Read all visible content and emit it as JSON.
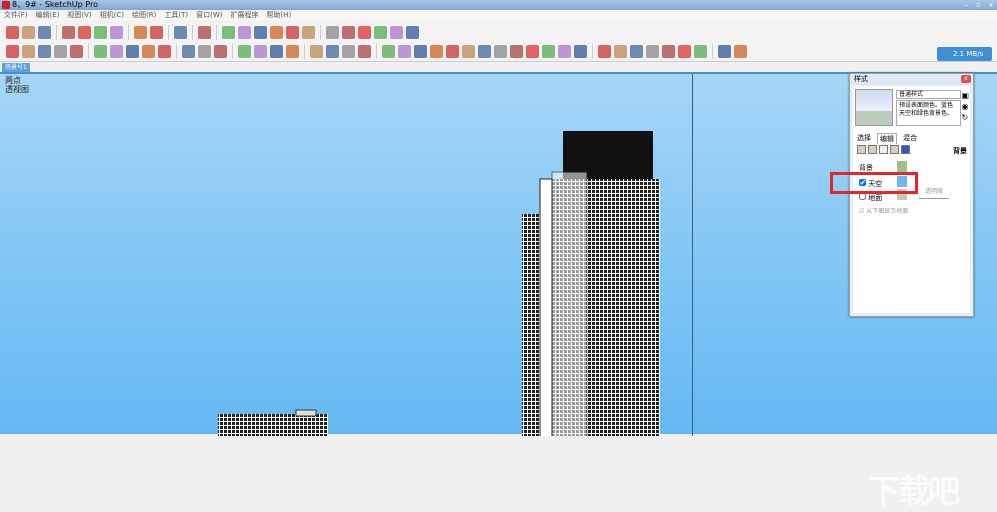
{
  "window": {
    "title": "8、9# - SketchUp Pro",
    "minimize": "–",
    "maximize": "▫",
    "close": "x"
  },
  "menu": [
    "文件(F)",
    "编辑(E)",
    "视图(V)",
    "相机(C)",
    "绘图(R)",
    "工具(T)",
    "窗口(W)",
    "扩展程序",
    "帮助(H)"
  ],
  "toolbar1": [
    "new-icon",
    "open-icon",
    "save-icon",
    "sep",
    "cut-icon",
    "copy-icon",
    "paste-icon",
    "erase-icon",
    "sep",
    "undo-icon",
    "redo-icon",
    "sep",
    "print-icon",
    "sep",
    "model-info-icon",
    "sep",
    "iso-view-icon",
    "top-view-icon",
    "front-view-icon",
    "right-view-icon",
    "back-view-icon",
    "left-view-icon",
    "sep",
    "xray-icon",
    "wireframe-icon",
    "hidden-line-icon",
    "shaded-icon",
    "textured-icon",
    "monochrome-icon"
  ],
  "toolbar2": [
    "select-icon",
    "eraser-icon",
    "pencil-icon",
    "arc-icon",
    "rectangle-icon",
    "sep",
    "push-pull-icon",
    "follow-me-icon",
    "move-icon",
    "rotate-icon",
    "scale-icon",
    "sep",
    "tape-icon",
    "text-icon",
    "paint-icon",
    "sep",
    "orbit-icon",
    "pan-icon",
    "zoom-icon",
    "zoom-extents-icon",
    "sep",
    "layer-icon",
    "component-icon",
    "material-icon",
    "style-icon",
    "sep",
    "section-icon",
    "section-fill-icon",
    "grid-icon",
    "stair-icon",
    "wall-icon",
    "roof-icon",
    "window-icon",
    "door-icon",
    "fence-icon",
    "column-icon",
    "beam-icon",
    "floor-icon",
    "railing-icon",
    "sep",
    "plugin1-icon",
    "plugin2-icon",
    "plugin3-icon",
    "plugin4-icon",
    "plugin5-icon",
    "plugin6-icon",
    "plugin7-icon",
    "sep",
    "3d-icon",
    "su-app-icon"
  ],
  "network": {
    "speed": "2.1 MB/s"
  },
  "scene_tab": "场景号1",
  "viewport": {
    "line1": "两点",
    "line2": "透视图"
  },
  "styles_panel": {
    "title": "样式",
    "style_name": "普通样式",
    "description": "预设表面颜色。蓝色天空和绿色背景色。",
    "tabs": [
      "选择",
      "编辑",
      "混合"
    ],
    "section": "背景",
    "bg_heading": "背景",
    "sky_label": "天空",
    "ground_label": "地面",
    "transparency": "透明度",
    "show_ground": "从下面显示地面",
    "sky_checked": true,
    "ground_checked": false,
    "colors": {
      "background": "#9dc18d",
      "sky": "#6ab8ee",
      "ground": "#c9c9a8"
    }
  },
  "watermark": "下载吧"
}
